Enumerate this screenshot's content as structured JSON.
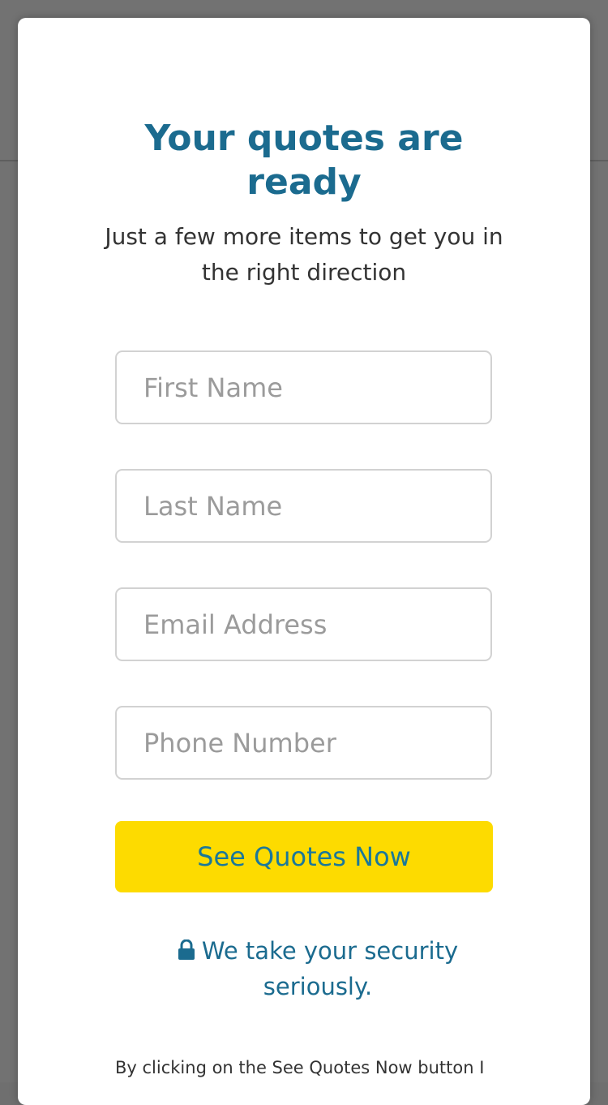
{
  "modal": {
    "title_line1": "Your quotes are",
    "title_line2": "ready",
    "subtitle": "Just a few more items to get you in the right direction"
  },
  "form": {
    "first_name_placeholder": "First Name",
    "last_name_placeholder": "Last Name",
    "email_placeholder": "Email Address",
    "phone_placeholder": "Phone Number",
    "submit_label": "See Quotes Now"
  },
  "security": {
    "icon": "lock-icon",
    "text": "We take your security seriously."
  },
  "disclaimer": {
    "text": "By clicking on the See Quotes Now button I"
  },
  "colors": {
    "accent": "#1b6b8f",
    "button": "#fddb00",
    "overlay": "#727272"
  }
}
